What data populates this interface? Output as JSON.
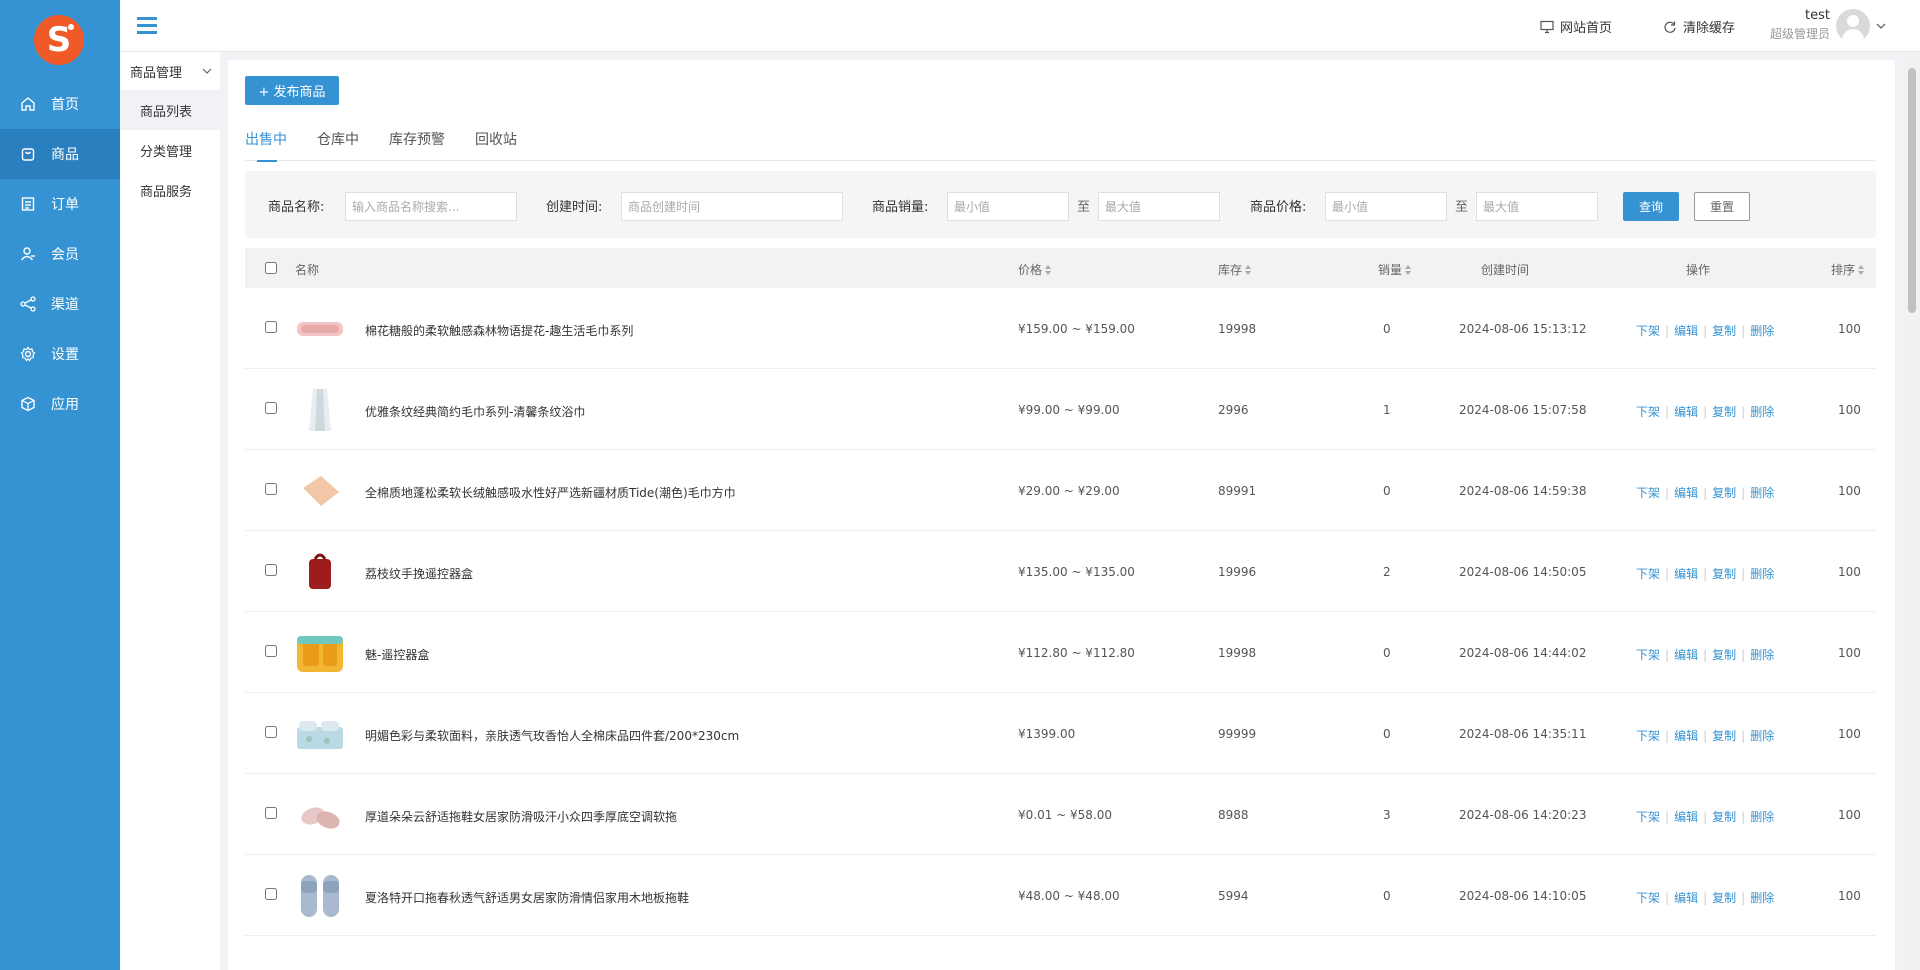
{
  "sidebar": {
    "logo_letter": "S",
    "items": [
      {
        "label": "首页",
        "icon": "home-icon"
      },
      {
        "label": "商品",
        "icon": "goods-icon"
      },
      {
        "label": "订单",
        "icon": "order-icon"
      },
      {
        "label": "会员",
        "icon": "member-icon"
      },
      {
        "label": "渠道",
        "icon": "channel-icon"
      },
      {
        "label": "设置",
        "icon": "gear-icon"
      },
      {
        "label": "应用",
        "icon": "app-icon"
      }
    ]
  },
  "subnav": {
    "group": "商品管理",
    "items": [
      "商品列表",
      "分类管理",
      "商品服务"
    ]
  },
  "header": {
    "site_home": "网站首页",
    "clear_cache": "清除缓存",
    "user_name": "test",
    "user_role": "超级管理员"
  },
  "toolbar": {
    "publish_label": "+ 发布商品"
  },
  "tabs": [
    "出售中",
    "仓库中",
    "库存预警",
    "回收站"
  ],
  "filter": {
    "name_label": "商品名称:",
    "name_placeholder": "输入商品名称搜索...",
    "time_label": "创建时间:",
    "time_placeholder": "商品创建时间",
    "sales_label": "商品销量:",
    "min_placeholder": "最小值",
    "max_placeholder": "最大值",
    "to_label": "至",
    "price_label": "商品价格:",
    "query_label": "查询",
    "reset_label": "重置"
  },
  "table": {
    "headers": {
      "name": "名称",
      "price": "价格",
      "stock": "库存",
      "sales": "销量",
      "created": "创建时间",
      "ops": "操作",
      "sort": "排序"
    },
    "ops": [
      "下架",
      "编辑",
      "复制",
      "删除"
    ],
    "rows": [
      {
        "name": "棉花糖般的柔软触感森林物语提花-趣生活毛巾系列",
        "price": "¥159.00 ~ ¥159.00",
        "stock": "19998",
        "sales": "0",
        "time": "2024-08-06 15:13:12",
        "sort": "100"
      },
      {
        "name": "优雅条纹经典简约毛巾系列-清馨条纹浴巾",
        "price": "¥99.00 ~ ¥99.00",
        "stock": "2996",
        "sales": "1",
        "time": "2024-08-06 15:07:58",
        "sort": "100"
      },
      {
        "name": "全棉质地蓬松柔软长绒触感吸水性好严选新疆材质Tide(潮色)毛巾方巾",
        "price": "¥29.00 ~ ¥29.00",
        "stock": "89991",
        "sales": "0",
        "time": "2024-08-06 14:59:38",
        "sort": "100"
      },
      {
        "name": "荔枝纹手挽遥控器盒",
        "price": "¥135.00 ~ ¥135.00",
        "stock": "19996",
        "sales": "2",
        "time": "2024-08-06 14:50:05",
        "sort": "100"
      },
      {
        "name": "魅-遥控器盒",
        "price": "¥112.80 ~ ¥112.80",
        "stock": "19998",
        "sales": "0",
        "time": "2024-08-06 14:44:02",
        "sort": "100"
      },
      {
        "name": "明媚色彩与柔软面料，亲肤透气玫香怡人全棉床品四件套/200*230cm",
        "price": "¥1399.00",
        "stock": "99999",
        "sales": "0",
        "time": "2024-08-06 14:35:11",
        "sort": "100"
      },
      {
        "name": "厚道朵朵云舒适拖鞋女居家防滑吸汗小众四季厚底空调软拖",
        "price": "¥0.01 ~ ¥58.00",
        "stock": "8988",
        "sales": "3",
        "time": "2024-08-06 14:20:23",
        "sort": "100"
      },
      {
        "name": "夏洛特开口拖春秋透气舒适男女居家防滑情侣家用木地板拖鞋",
        "price": "¥48.00 ~ ¥48.00",
        "stock": "5994",
        "sales": "0",
        "time": "2024-08-06 14:10:05",
        "sort": "100"
      }
    ]
  }
}
